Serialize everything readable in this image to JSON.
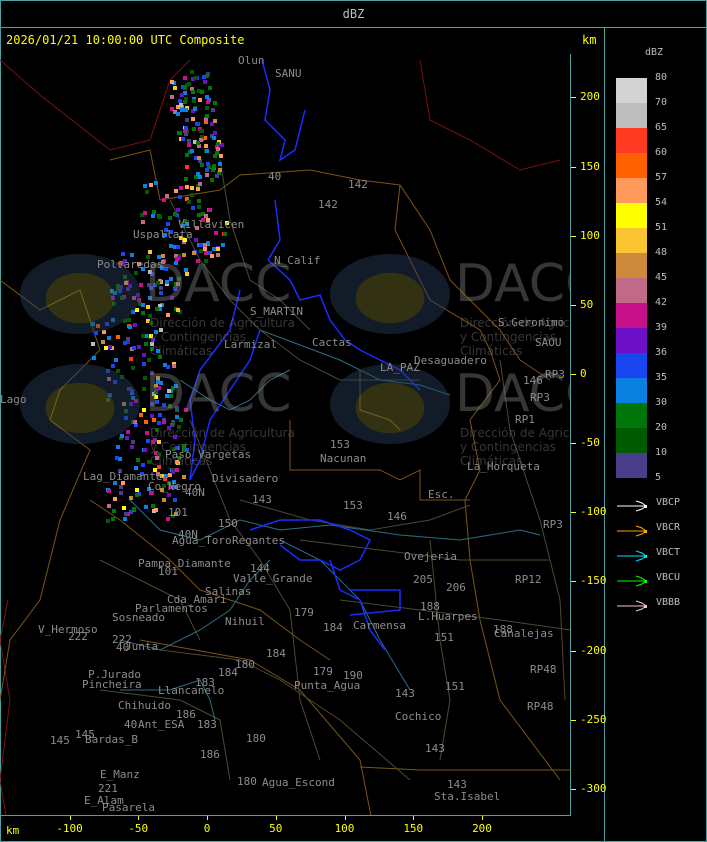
{
  "top_bar": {
    "title": "dBZ"
  },
  "header": {
    "datetime": "2026/01/21 10:00:00 UTC Composite",
    "unit_right": "km",
    "unit_bottom": "km"
  },
  "axes": {
    "x_ticks": [
      "-100",
      "-50",
      "0",
      "50",
      "100",
      "150",
      "200"
    ],
    "y_ticks": [
      "200",
      "150",
      "100",
      "50",
      "0",
      "-50",
      "-100",
      "-150",
      "-200",
      "-250",
      "-300"
    ]
  },
  "legend": {
    "unit": "dBZ",
    "levels": [
      {
        "label": "80",
        "color": "#d3d3d3"
      },
      {
        "label": "70",
        "color": "#bdbdbd"
      },
      {
        "label": "65",
        "color": "#ff3a20"
      },
      {
        "label": "60",
        "color": "#ff6100"
      },
      {
        "label": "57",
        "color": "#ff9a5a"
      },
      {
        "label": "54",
        "color": "#ffff00"
      },
      {
        "label": "51",
        "color": "#fbc531"
      },
      {
        "label": "48",
        "color": "#cd8a3c"
      },
      {
        "label": "45",
        "color": "#c06a88"
      },
      {
        "label": "42",
        "color": "#c8108a"
      },
      {
        "label": "39",
        "color": "#6c10c8"
      },
      {
        "label": "36",
        "color": "#1a46f0"
      },
      {
        "label": "35",
        "color": "#0a80e0"
      },
      {
        "label": "30",
        "color": "#00760a"
      },
      {
        "label": "20",
        "color": "#005a00"
      },
      {
        "label": "10",
        "color": "#4a3e8a"
      },
      {
        "label": "5",
        "color": ""
      }
    ]
  },
  "radar_sites": [
    {
      "name": "VBCP",
      "color": "#ffffff"
    },
    {
      "name": "VBCR",
      "color": "#ffa500"
    },
    {
      "name": "VBCT",
      "color": "#00e5ff"
    },
    {
      "name": "VBCU",
      "color": "#00ff00"
    },
    {
      "name": "VBBB",
      "color": "#ffc0cb"
    }
  ],
  "watermark": {
    "logo_text": "DACC",
    "line1": "Dirección de Agricultura",
    "line2": "y Contingencias Climáticas",
    "url": "http://www.contingencias.mendoza.gov.ar"
  },
  "places": [
    "Olun",
    "SANU",
    "Villavicen",
    "Uspallata",
    "Polvaredas",
    "N_Calif",
    "S_MARTIN",
    "Cactas",
    "Larmizal",
    "Desaguadero",
    "LA_PAZ",
    "S.Geronimo",
    "SAOU",
    "RP3",
    "RP3",
    "RP1",
    "146",
    "153",
    "Nacunan",
    "La_Horqueta",
    "Esc.",
    "Paso_Vargetas",
    "Lag_Diamante",
    "Co_Negro",
    "Divisadero",
    "40N",
    "101",
    "150",
    "Agua_Toro",
    "Regantes",
    "Pampa_Diamante",
    "Valle_Grande",
    "Salinas",
    "Cda_Amari",
    "Parlamentos",
    "Sosneado",
    "Nihuil",
    "V_Hermoso",
    "Junta",
    "P.Jurado",
    "Pincheira",
    "Llancanelo",
    "Chihuido",
    "Ant_ESA",
    "Bardas_B",
    "E_Manz",
    "E_Alam",
    "Pasarela",
    "Punta_Agua",
    "Agua_Escond",
    "Ovejeria",
    "L.Huarpes",
    "Carmensa",
    "Canalejas",
    "RP12",
    "RP3",
    "RP48",
    "RP48",
    "Cochico",
    "Sta.Isabel",
    "Lago",
    "142",
    "142",
    "40",
    "153",
    "146",
    "205",
    "206",
    "188",
    "151",
    "151",
    "143",
    "143",
    "143",
    "179",
    "184",
    "184",
    "180",
    "184",
    "179",
    "190",
    "183",
    "186",
    "183",
    "180",
    "186",
    "180",
    "145",
    "145",
    "221",
    "222",
    "222",
    "144",
    "143",
    "188",
    "40N",
    "101",
    "40",
    "40"
  ]
}
